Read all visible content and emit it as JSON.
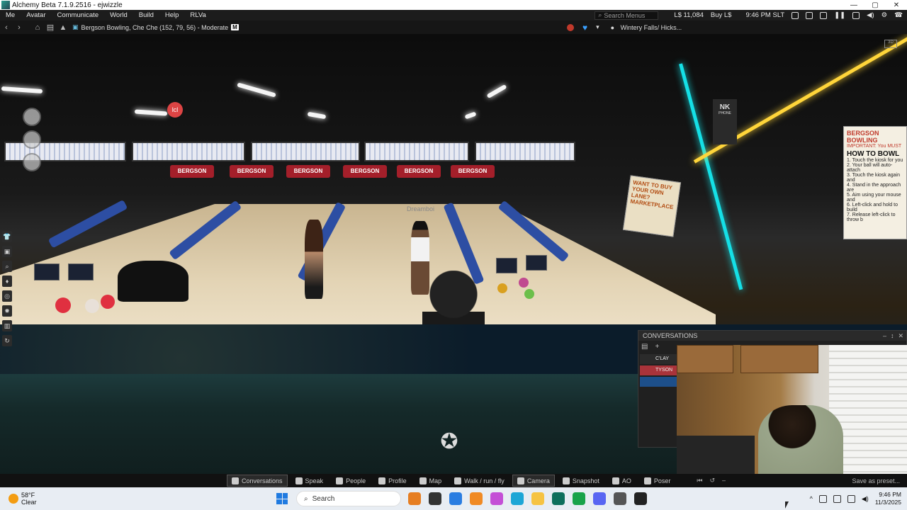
{
  "window": {
    "title": "Alchemy Beta 7.1.9.2516 - ejwizzle",
    "controls": [
      "—",
      "▢",
      "✕"
    ]
  },
  "menubar": {
    "items": [
      "Me",
      "Avatar",
      "Communicate",
      "World",
      "Build",
      "Help",
      "RLVa"
    ],
    "search_placeholder": "Search Menus",
    "balance": "L$ 11,084",
    "buy_label": "Buy L$",
    "time": "9:46 PM SLT"
  },
  "navbar": {
    "location": "Bergson Bowling, Che Che (152, 79, 56) - Moderate",
    "rating": "M",
    "favorite": "Wintery Falls/ Hicks..."
  },
  "world": {
    "lane_banners": [
      "BERGSON",
      "BERGSON",
      "BERGSON",
      "BERGSON",
      "BERGSON",
      "BERGSON"
    ],
    "sign_buy": "WANT TO BUY YOUR OWN LANE? MARKETPLACE",
    "sign_how": {
      "brand": "BERGSON BOWLING",
      "important": "IMPORTANT: You MUST",
      "heading": "HOW TO BOWL",
      "steps": [
        "1. Touch the kiosk for you",
        "2. Your ball will auto-attach",
        "3. Touch the kiosk again and",
        "4. Stand in the approach are",
        "5. Aim using your mouse and",
        "6. Left-click and hold to build",
        "7. Release left-click to throw b"
      ]
    },
    "nk_logo": "NK",
    "nk_sub": "PHONE",
    "hud_badge": "lcl",
    "lane_label": "Dreamboi"
  },
  "conversations": {
    "title": "CONVERSATIONS",
    "tabs": [
      {
        "label": "C'LAY ES"
      },
      {
        "label": "TYSON S"
      },
      {
        "label": ""
      }
    ]
  },
  "sl_toolbar": {
    "buttons": [
      {
        "label": "Conversations",
        "icon": "chat-bubble-icon",
        "active": true
      },
      {
        "label": "Speak",
        "icon": "microphone-icon",
        "active": false
      },
      {
        "label": "People",
        "icon": "people-icon",
        "active": false
      },
      {
        "label": "Profile",
        "icon": "profile-icon",
        "active": false
      },
      {
        "label": "Map",
        "icon": "map-icon",
        "active": false
      },
      {
        "label": "Walk / run / fly",
        "icon": "walk-icon",
        "active": false
      },
      {
        "label": "Camera",
        "icon": "camera-icon",
        "active": true
      },
      {
        "label": "Snapshot",
        "icon": "snapshot-icon",
        "active": false
      },
      {
        "label": "AO",
        "icon": "ao-icon",
        "active": false
      },
      {
        "label": "Poser",
        "icon": "poser-icon",
        "active": false
      }
    ],
    "preset_label": "Save as preset..."
  },
  "taskbar": {
    "temperature": "58°F",
    "weather": "Clear",
    "search_placeholder": "Search",
    "time": "9:46 PM",
    "date": "11/3/2025",
    "apps": [
      "#e67e22",
      "#333333",
      "#2a7de1",
      "#f08a24",
      "#c44fd6",
      "#1da6d6",
      "#f6c342",
      "#0e6f5c",
      "#19a34a",
      "#5865f2",
      "#555555",
      "#222222"
    ]
  },
  "colors": {
    "neon_cyan": "#15e0e6",
    "neon_yellow": "#ffd53a",
    "gutter_blue": "#2d4ea3",
    "banner_red": "#a41f2a",
    "tab_red": "#a9333a",
    "tab_blue": "#1d4f8a"
  }
}
